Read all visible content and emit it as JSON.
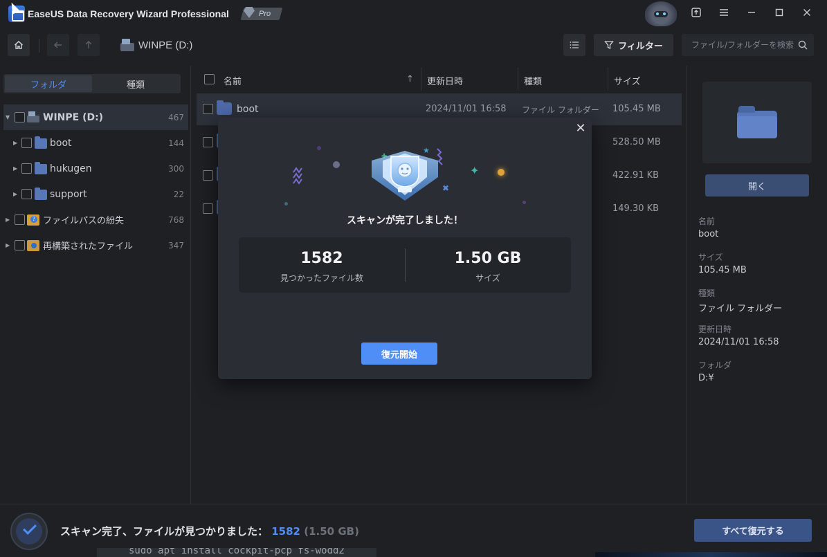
{
  "window": {
    "title": "EaseUS Data Recovery Wizard Professional",
    "badge": "Pro"
  },
  "toolbar": {
    "path": "WINPE (D:)",
    "filter_label": "フィルター",
    "search_placeholder": "ファイル/フォルダーを検索"
  },
  "left_panel": {
    "tabs": [
      "フォルダ",
      "種類"
    ],
    "tree": [
      {
        "label": "WINPE (D:)",
        "count": "467"
      },
      {
        "label": "boot",
        "count": "144"
      },
      {
        "label": "hukugen",
        "count": "300"
      },
      {
        "label": "support",
        "count": "22"
      },
      {
        "label": "ファイルパスの紛失",
        "count": "768"
      },
      {
        "label": "再構築されたファイル",
        "count": "347"
      }
    ]
  },
  "list": {
    "columns": [
      "名前",
      "更新日時",
      "種類",
      "サイズ"
    ],
    "rows": [
      {
        "name": "boot",
        "date": "2024/11/01 16:58",
        "type": "ファイル フォルダー",
        "size": "105.45 MB"
      },
      {
        "name": "",
        "date": "",
        "type": "",
        "size": "528.50 MB"
      },
      {
        "name": "",
        "date": "",
        "type": "",
        "size": "422.91 KB"
      },
      {
        "name": "",
        "date": "",
        "type": "",
        "size": "149.30 KB"
      }
    ]
  },
  "details": {
    "open_label": "開く",
    "props": [
      {
        "label": "名前",
        "value": "boot"
      },
      {
        "label": "サイズ",
        "value": "105.45 MB"
      },
      {
        "label": "種類",
        "value": "ファイル フォルダー"
      },
      {
        "label": "更新日時",
        "value": "2024/11/01 16:58"
      },
      {
        "label": "フォルダ",
        "value": "D:¥"
      }
    ]
  },
  "modal": {
    "title": "スキャンが完了しました！",
    "stats": [
      {
        "value": "1582",
        "label": "見つかったファイル数"
      },
      {
        "value": "1.50 GB",
        "label": "サイズ"
      }
    ],
    "start_label": "復元開始"
  },
  "status": {
    "prefix": "スキャン完了、ファイルが見つかりました：",
    "count": "1582",
    "size": "(1.50 GB)",
    "recover_all_label": "すべて復元する"
  },
  "background_terminal": {
    "text": "sudo apt install cockpit-pcp fs-wodd2"
  },
  "colors": {
    "accent": "#4f8ef7",
    "background": "#1e2024",
    "panel": "#2a2d33"
  },
  "icons": [
    "app-logo-icon",
    "home-icon",
    "back-arrow-icon",
    "up-arrow-icon",
    "drive-icon",
    "list-view-icon",
    "filter-icon",
    "search-icon",
    "folder-icon",
    "close-icon",
    "trophy-icon",
    "checkmark-icon",
    "minimize-icon",
    "maximize-icon",
    "menu-icon",
    "export-icon"
  ]
}
